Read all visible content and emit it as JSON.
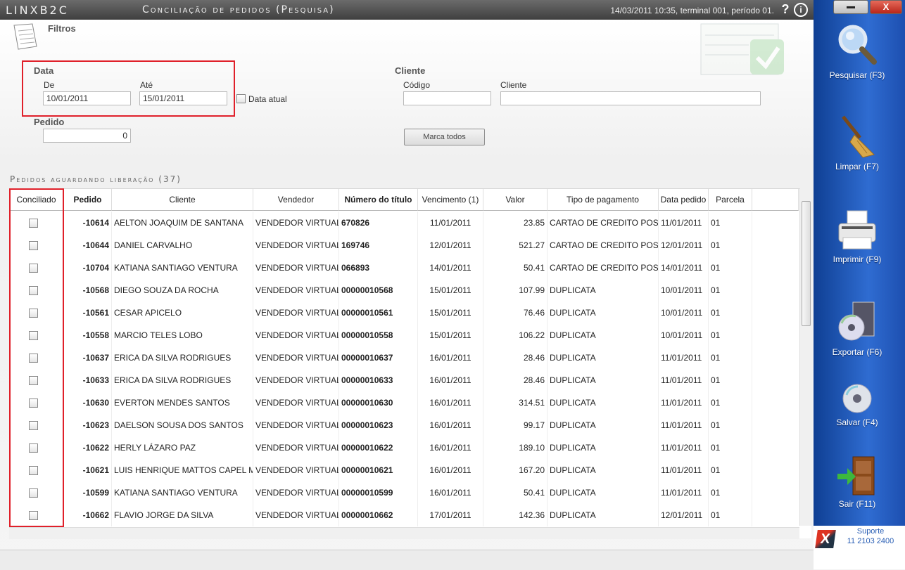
{
  "app": {
    "brand": "LINXB2C",
    "title": "Conciliação de pedidos (Pesquisa)",
    "status": "14/03/2011 10:35, terminal 001, período 01.",
    "help": "?",
    "info": "i",
    "close": "X"
  },
  "filters": {
    "title": "Filtros",
    "data_label": "Data",
    "de_label": "De",
    "de_value": "10/01/2011",
    "ate_label": "Até",
    "ate_value": "15/01/2011",
    "data_atual_label": "Data atual",
    "pedido_label": "Pedido",
    "pedido_value": "0",
    "cliente_group_label": "Cliente",
    "codigo_label": "Código",
    "codigo_value": "",
    "cliente_label": "Cliente",
    "cliente_value": "",
    "marca_todos": "Marca todos"
  },
  "section": {
    "title": "Pedidos aguardando liberação (37)"
  },
  "columns": [
    "Conciliado",
    "Pedido",
    "Cliente",
    "Vendedor",
    "Número do título",
    "Vencimento (1)",
    "Valor",
    "Tipo de pagamento",
    "Data pedido",
    "Parcela"
  ],
  "rows": [
    {
      "pedido": "-10614",
      "cliente": "AELTON JOAQUIM DE SANTANA",
      "vendedor": "VENDEDOR VIRTUAL",
      "titulo": "670826",
      "vencimento": "11/01/2011",
      "valor": "23.85",
      "tipo": "CARTAO DE CREDITO POS",
      "data": "11/01/2011",
      "parcela": "01"
    },
    {
      "pedido": "-10644",
      "cliente": "DANIEL CARVALHO",
      "vendedor": "VENDEDOR VIRTUAL",
      "titulo": "169746",
      "vencimento": "12/01/2011",
      "valor": "521.27",
      "tipo": "CARTAO DE CREDITO POS",
      "data": "12/01/2011",
      "parcela": "01"
    },
    {
      "pedido": "-10704",
      "cliente": "KATIANA SANTIAGO VENTURA",
      "vendedor": "VENDEDOR VIRTUAL",
      "titulo": "066893",
      "vencimento": "14/01/2011",
      "valor": "50.41",
      "tipo": "CARTAO DE CREDITO POS",
      "data": "14/01/2011",
      "parcela": "01"
    },
    {
      "pedido": "-10568",
      "cliente": "DIEGO  SOUZA DA ROCHA",
      "vendedor": "VENDEDOR VIRTUAL",
      "titulo": "00000010568",
      "vencimento": "15/01/2011",
      "valor": "107.99",
      "tipo": "DUPLICATA",
      "data": "10/01/2011",
      "parcela": "01"
    },
    {
      "pedido": "-10561",
      "cliente": "CESAR APICELO",
      "vendedor": "VENDEDOR VIRTUAL",
      "titulo": "00000010561",
      "vencimento": "15/01/2011",
      "valor": "76.46",
      "tipo": "DUPLICATA",
      "data": "10/01/2011",
      "parcela": "01"
    },
    {
      "pedido": "-10558",
      "cliente": "MARCIO TELES LOBO",
      "vendedor": "VENDEDOR VIRTUAL",
      "titulo": "00000010558",
      "vencimento": "15/01/2011",
      "valor": "106.22",
      "tipo": "DUPLICATA",
      "data": "10/01/2011",
      "parcela": "01"
    },
    {
      "pedido": "-10637",
      "cliente": "ERICA DA SILVA RODRIGUES",
      "vendedor": "VENDEDOR VIRTUAL",
      "titulo": "00000010637",
      "vencimento": "16/01/2011",
      "valor": "28.46",
      "tipo": "DUPLICATA",
      "data": "11/01/2011",
      "parcela": "01"
    },
    {
      "pedido": "-10633",
      "cliente": "ERICA DA SILVA RODRIGUES",
      "vendedor": "VENDEDOR VIRTUAL",
      "titulo": "00000010633",
      "vencimento": "16/01/2011",
      "valor": "28.46",
      "tipo": "DUPLICATA",
      "data": "11/01/2011",
      "parcela": "01"
    },
    {
      "pedido": "-10630",
      "cliente": "EVERTON MENDES SANTOS",
      "vendedor": "VENDEDOR VIRTUAL",
      "titulo": "00000010630",
      "vencimento": "16/01/2011",
      "valor": "314.51",
      "tipo": "DUPLICATA",
      "data": "11/01/2011",
      "parcela": "01"
    },
    {
      "pedido": "-10623",
      "cliente": "DAELSON SOUSA DOS SANTOS",
      "vendedor": "VENDEDOR VIRTUAL",
      "titulo": "00000010623",
      "vencimento": "16/01/2011",
      "valor": "99.17",
      "tipo": "DUPLICATA",
      "data": "11/01/2011",
      "parcela": "01"
    },
    {
      "pedido": "-10622",
      "cliente": "HERLY LÁZARO PAZ",
      "vendedor": "VENDEDOR VIRTUAL",
      "titulo": "00000010622",
      "vencimento": "16/01/2011",
      "valor": "189.10",
      "tipo": "DUPLICATA",
      "data": "11/01/2011",
      "parcela": "01"
    },
    {
      "pedido": "-10621",
      "cliente": "LUIS HENRIQUE MATTOS CAPEL M",
      "vendedor": "VENDEDOR VIRTUAL",
      "titulo": "00000010621",
      "vencimento": "16/01/2011",
      "valor": "167.20",
      "tipo": "DUPLICATA",
      "data": "11/01/2011",
      "parcela": "01"
    },
    {
      "pedido": "-10599",
      "cliente": "KATIANA SANTIAGO VENTURA",
      "vendedor": "VENDEDOR VIRTUAL",
      "titulo": "00000010599",
      "vencimento": "16/01/2011",
      "valor": "50.41",
      "tipo": "DUPLICATA",
      "data": "11/01/2011",
      "parcela": "01"
    },
    {
      "pedido": "-10662",
      "cliente": "FLAVIO JORGE DA SILVA",
      "vendedor": "VENDEDOR VIRTUAL",
      "titulo": "00000010662",
      "vencimento": "17/01/2011",
      "valor": "142.36",
      "tipo": "DUPLICATA",
      "data": "12/01/2011",
      "parcela": "01"
    }
  ],
  "actions": [
    {
      "label": "Pesquisar (F3)",
      "icon": "magnifier-icon"
    },
    {
      "label": "Limpar (F7)",
      "icon": "broom-icon"
    },
    {
      "label": "Imprimir (F9)",
      "icon": "printer-icon"
    },
    {
      "label": "Exportar (F6)",
      "icon": "export-disc-icon"
    },
    {
      "label": "Salvar (F4)",
      "icon": "disc-icon"
    },
    {
      "label": "Sair (F11)",
      "icon": "exit-door-icon"
    }
  ],
  "suporte": {
    "label": "Suporte",
    "phone": "11 2103 2400",
    "logo": "X"
  }
}
